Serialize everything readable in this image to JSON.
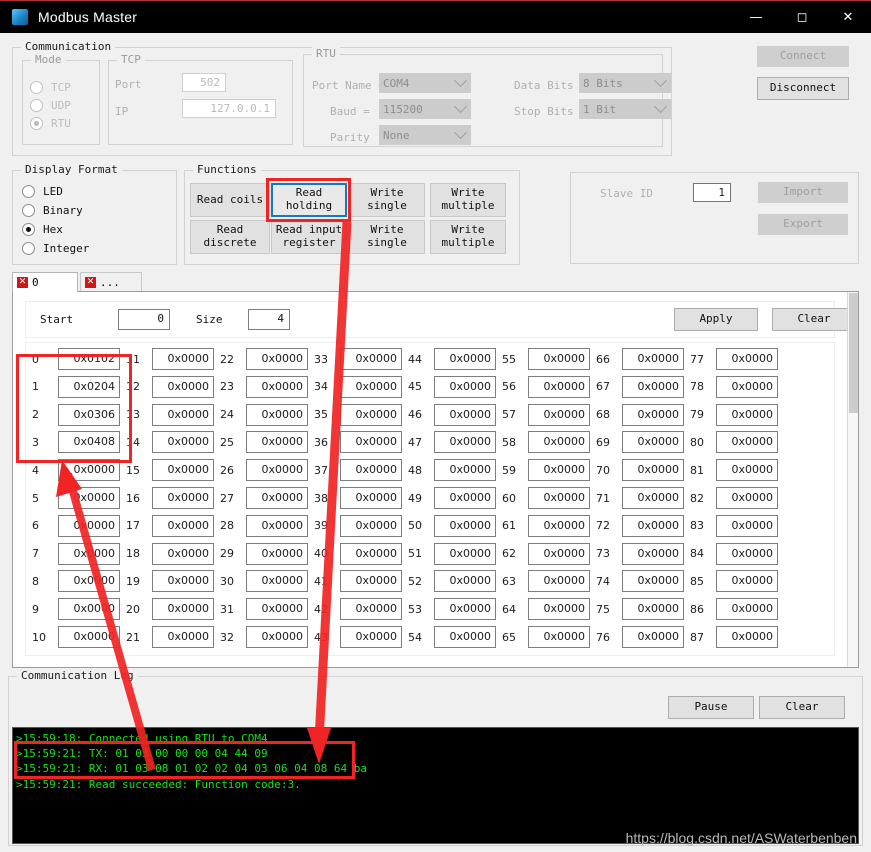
{
  "window": {
    "title": "Modbus Master",
    "icon": "cube-icon",
    "minimize": "—",
    "maximize": "☐",
    "close": "✕"
  },
  "communication": {
    "legend": "Communication",
    "mode": {
      "legend": "Mode",
      "options": [
        "TCP",
        "UDP",
        "RTU"
      ],
      "selected": "RTU"
    },
    "tcp": {
      "legend": "TCP",
      "port_label": "Port",
      "port_value": "502",
      "ip_label": "IP",
      "ip_value": "127.0.0.1"
    },
    "rtu": {
      "legend": "RTU",
      "port_name_label": "Port Name =",
      "port_name_value": "COM4",
      "baud_label": "Baud =",
      "baud_value": "115200",
      "parity_label": "Parity",
      "parity_value": "None",
      "data_bits_label": "Data Bits =",
      "data_bits_value": "8 Bits",
      "stop_bits_label": "Stop Bits =",
      "stop_bits_value": "1 Bit"
    },
    "connect_label": "Connect",
    "disconnect_label": "Disconnect"
  },
  "display_format": {
    "legend": "Display Format",
    "options": [
      "LED",
      "Binary",
      "Hex",
      "Integer"
    ],
    "selected": "Hex"
  },
  "functions": {
    "legend": "Functions",
    "buttons": [
      {
        "label": "Read coils",
        "selected": false
      },
      {
        "label": "Read\nholding",
        "selected": true
      },
      {
        "label": "Write\nsingle",
        "selected": false
      },
      {
        "label": "Write\nmultiple",
        "selected": false
      },
      {
        "label": "Read\ndiscrete",
        "selected": false
      },
      {
        "label": "Read input\nregister",
        "selected": false
      },
      {
        "label": "Write\nsingle",
        "selected": false
      },
      {
        "label": "Write\nmultiple",
        "selected": false
      }
    ]
  },
  "slave": {
    "id_label": "Slave ID",
    "id_value": "1",
    "import_label": "Import",
    "export_label": "Export"
  },
  "tabs": [
    {
      "label": "0",
      "close": "✕",
      "active": true
    },
    {
      "label": "...",
      "close": "✕",
      "active": false
    }
  ],
  "toolbar": {
    "start_label": "Start",
    "start_value": "0",
    "size_label": "Size",
    "size_value": "4",
    "apply_label": "Apply",
    "clear_label": "Clear"
  },
  "registers": {
    "columns": 8,
    "rows": 11,
    "indices": [
      0,
      1,
      2,
      3,
      4,
      5,
      6,
      7,
      8,
      9,
      10,
      11,
      12,
      13,
      14,
      15,
      16,
      17,
      18,
      19,
      20,
      21,
      22,
      23,
      24,
      25,
      26,
      27,
      28,
      29,
      30,
      31,
      32,
      33,
      34,
      35,
      36,
      37,
      38,
      39,
      40,
      41,
      42,
      43,
      44,
      45,
      46,
      47,
      48,
      49,
      50,
      51,
      52,
      53,
      54,
      55,
      56,
      57,
      58,
      59,
      60,
      61,
      62,
      63,
      64,
      65,
      66,
      67,
      68,
      69,
      70,
      71,
      72,
      73,
      74,
      75,
      76,
      77,
      78,
      79,
      80,
      81,
      82,
      83,
      84,
      85,
      86,
      87
    ],
    "values": [
      "0x0102",
      "0x0204",
      "0x0306",
      "0x0408",
      "0x0000",
      "0x0000",
      "0x0000",
      "0x0000",
      "0x0000",
      "0x0000",
      "0x0000",
      "0x0000",
      "0x0000",
      "0x0000",
      "0x0000",
      "0x0000",
      "0x0000",
      "0x0000",
      "0x0000",
      "0x0000",
      "0x0000",
      "0x0000",
      "0x0000",
      "0x0000",
      "0x0000",
      "0x0000",
      "0x0000",
      "0x0000",
      "0x0000",
      "0x0000",
      "0x0000",
      "0x0000",
      "0x0000",
      "0x0000",
      "0x0000",
      "0x0000",
      "0x0000",
      "0x0000",
      "0x0000",
      "0x0000",
      "0x0000",
      "0x0000",
      "0x0000",
      "0x0000",
      "0x0000",
      "0x0000",
      "0x0000",
      "0x0000",
      "0x0000",
      "0x0000",
      "0x0000",
      "0x0000",
      "0x0000",
      "0x0000",
      "0x0000",
      "0x0000",
      "0x0000",
      "0x0000",
      "0x0000",
      "0x0000",
      "0x0000",
      "0x0000",
      "0x0000",
      "0x0000",
      "0x0000",
      "0x0000",
      "0x0000",
      "0x0000",
      "0x0000",
      "0x0000",
      "0x0000",
      "0x0000",
      "0x0000",
      "0x0000",
      "0x0000",
      "0x0000",
      "0x0000",
      "0x0000",
      "0x0000",
      "0x0000",
      "0x0000",
      "0x0000",
      "0x0000",
      "0x0000",
      "0x0000",
      "0x0000",
      "0x0000",
      "0x0000"
    ]
  },
  "log": {
    "legend": "Communication Log",
    "pause_label": "Pause",
    "clear_label": "Clear",
    "lines": [
      ">15:59:18: Connected using RTU to COM4",
      ">15:59:21: TX: 01 03 00 00 00 04 44 09",
      ">15:59:21: RX: 01 03 08 01 02 02 04 03 06 04 08 64 ba",
      ">15:59:21: Read succeeded: Function code:3."
    ],
    "text_color": "#19e019"
  },
  "watermark": "https://blog.csdn.net/ASWaterbenben",
  "annotation_color": "#f02424",
  "selection_color": "#1179c8"
}
